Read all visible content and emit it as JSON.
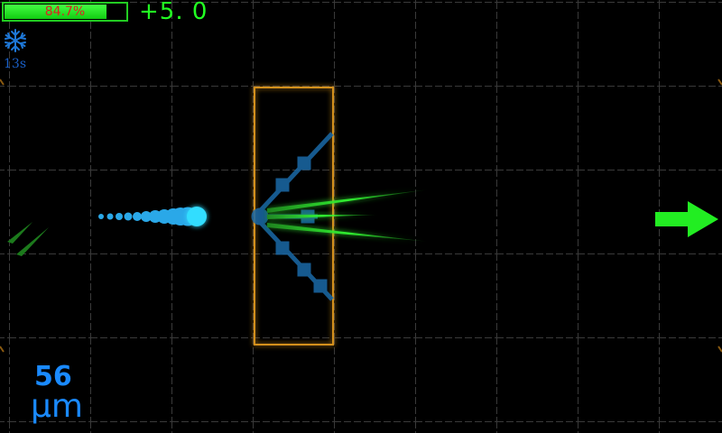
{
  "hud": {
    "progress": 0.847,
    "progress_label": "84.7%",
    "score": "+5. 0",
    "powerup_icon": "snowflake-icon",
    "timer": "13s",
    "size_value": "56",
    "size_unit": "µm"
  },
  "colors": {
    "progress_fill": "#22dd22",
    "progress_text": "#e02020",
    "score": "#22ff22",
    "beam": "#33ccff",
    "size_text": "#1a8aff",
    "obstacle_border": "#d4901c",
    "next_arrow": "#22ee22",
    "grid": "#3a3a3a"
  },
  "controls": {
    "next_arrow_icon": "right-arrow-icon"
  }
}
